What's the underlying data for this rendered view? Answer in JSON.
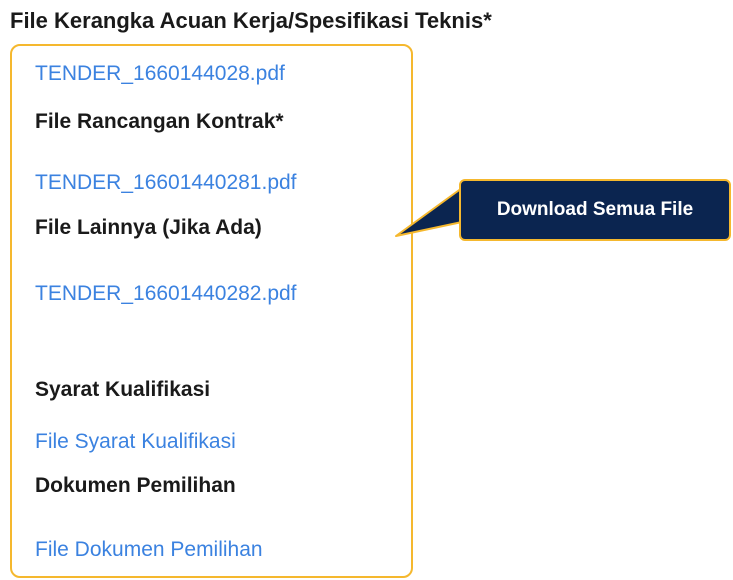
{
  "heading": "File Kerangka Acuan Kerja/Spesifikasi Teknis*",
  "files": [
    {
      "kind": "link",
      "text": "TENDER_1660144028.pdf"
    },
    {
      "kind": "label",
      "text": "File Rancangan Kontrak*"
    },
    {
      "kind": "link",
      "text": "TENDER_16601440281.pdf"
    },
    {
      "kind": "label",
      "text": "File Lainnya (Jika Ada)"
    },
    {
      "kind": "link",
      "text": "TENDER_16601440282.pdf"
    },
    {
      "kind": "label",
      "text": "Syarat Kualifikasi"
    },
    {
      "kind": "link",
      "text": "File Syarat Kualifikasi"
    },
    {
      "kind": "label",
      "text": "Dokumen Pemilihan"
    },
    {
      "kind": "link",
      "text": "File Dokumen Pemilihan"
    }
  ],
  "callout": {
    "label": "Download Semua File"
  },
  "colors": {
    "highlight": "#f5b82e",
    "callout_bg": "#0b2550",
    "link": "#3b82e0"
  }
}
